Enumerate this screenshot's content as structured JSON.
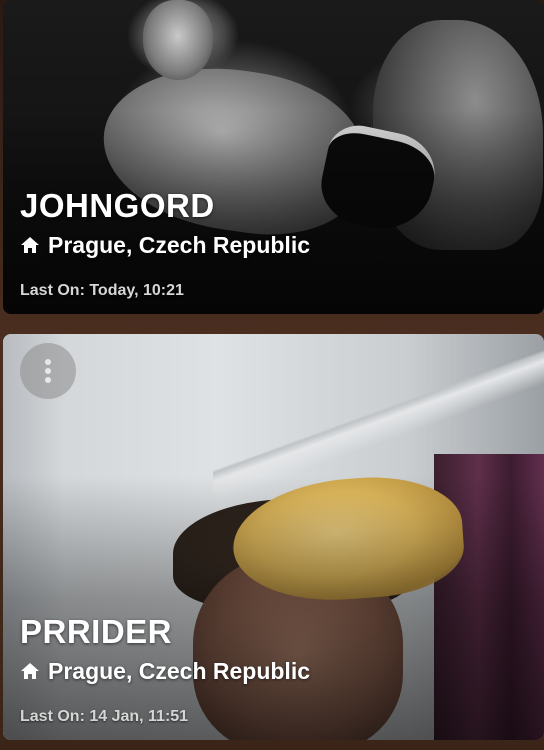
{
  "profiles": [
    {
      "username": "JOHNGORD",
      "location": "Prague, Czech Republic",
      "last_on": "Last On: Today, 10:21",
      "location_icon": "home-icon"
    },
    {
      "username": "PRRIDER",
      "location": "Prague, Czech Republic",
      "last_on": "Last On: 14 Jan, 11:51",
      "location_icon": "home-icon",
      "menu_icon": "more-vertical-icon"
    }
  ],
  "colors": {
    "text": "#ffffff",
    "muted_text": "#d6d6d6",
    "background": "#3a2418"
  }
}
